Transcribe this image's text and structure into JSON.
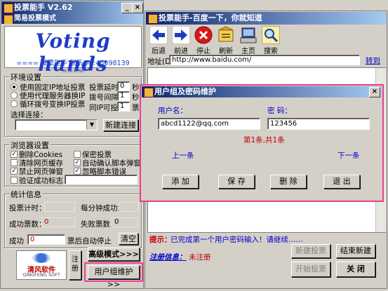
{
  "left": {
    "title": "投票能手 V2.62",
    "mode_title": "简易投票模式",
    "logo_text": "Voting hands",
    "tagline": "==== 投票能手 联系QQ:43098139 ====",
    "env": {
      "legend": "环境设置",
      "radios": [
        {
          "label": "使用固定IP地址投票",
          "checked": true
        },
        {
          "label": "使用代理服务器换IP",
          "checked": false
        },
        {
          "label": "循环拨号变换IP投票",
          "checked": false
        }
      ],
      "delay_label": "投票延时",
      "delay_value": "0",
      "delay_unit": "秒",
      "dial_label": "拨号间隔",
      "dial_value": "1",
      "dial_unit": "秒",
      "same_ip_label": "同IP可投",
      "same_ip_value": "1",
      "same_ip_unit": "票",
      "select_label": "选择连接：",
      "new_conn_button": "新建连接"
    },
    "browser": {
      "legend": "浏览器设置",
      "checks": [
        {
          "label": "删除Cookies",
          "checked": true
        },
        {
          "label": "保密投票",
          "checked": false
        },
        {
          "label": "清除网页缓存",
          "checked": false
        },
        {
          "label": "自动确认脚本弹窗",
          "checked": true
        },
        {
          "label": "禁止网页弹窗",
          "checked": true
        },
        {
          "label": "忽略脚本错误",
          "checked": true
        },
        {
          "label": "验证成功标志：",
          "checked": false
        }
      ]
    },
    "stats": {
      "legend": "统计信息",
      "timer_label": "投票计时：",
      "per_min_label": "每分钟成功：",
      "success_label": "成功票数：",
      "success_value": "0",
      "fail_label": "失败票数：",
      "fail_value": "0",
      "clear_button": "清空",
      "stop_after_label": "票后自动停止",
      "stop_after_prefix": "成功",
      "stop_after_value": "0"
    },
    "advanced_button": "高级模式>>>",
    "user_group_button": "用户组维护>>",
    "company_logo_text": "清风软件",
    "company_logo_sub": "QINGFENG SOFT",
    "register_label": "注\n册"
  },
  "right": {
    "title": "投票能手-百度一下，你就知道",
    "toolbar": [
      {
        "label": "后退",
        "icon": "back-arrow-icon"
      },
      {
        "label": "前进",
        "icon": "forward-arrow-icon"
      },
      {
        "label": "停止",
        "icon": "stop-icon"
      },
      {
        "label": "刷新",
        "icon": "refresh-icon"
      },
      {
        "label": "主页",
        "icon": "home-icon"
      },
      {
        "label": "搜索",
        "icon": "search-icon"
      }
    ],
    "address_label": "地址(D):",
    "address_value": "http://www.baidu.com/",
    "go_button": "转到",
    "hint_label": "提示：",
    "hint_text": "已完成第一个用户密码输入！请继续……",
    "reg_info_label": "注册信息：",
    "reg_info_value": "未注册",
    "new_vote_button": "新建投票",
    "end_new_button": "结束新建",
    "start_vote_button": "开始投票",
    "close_button": "关 闭"
  },
  "dialog": {
    "title": "用户组及密码维护",
    "user_label": "用户名：",
    "pwd_label": "密  码：",
    "user_value": "abcd1122@qq.com",
    "pwd_value": "123456",
    "record_text": "第1条,共1条",
    "prev_link": "上一条",
    "next_link": "下一条",
    "add_button": "添 加",
    "save_button": "保 存",
    "delete_button": "删 除",
    "exit_button": "退 出"
  },
  "colors": {
    "highlight": "#e83e8c",
    "link_blue": "#0000cc",
    "red_text": "#c00000",
    "logo_blue": "#1e3cc8"
  }
}
